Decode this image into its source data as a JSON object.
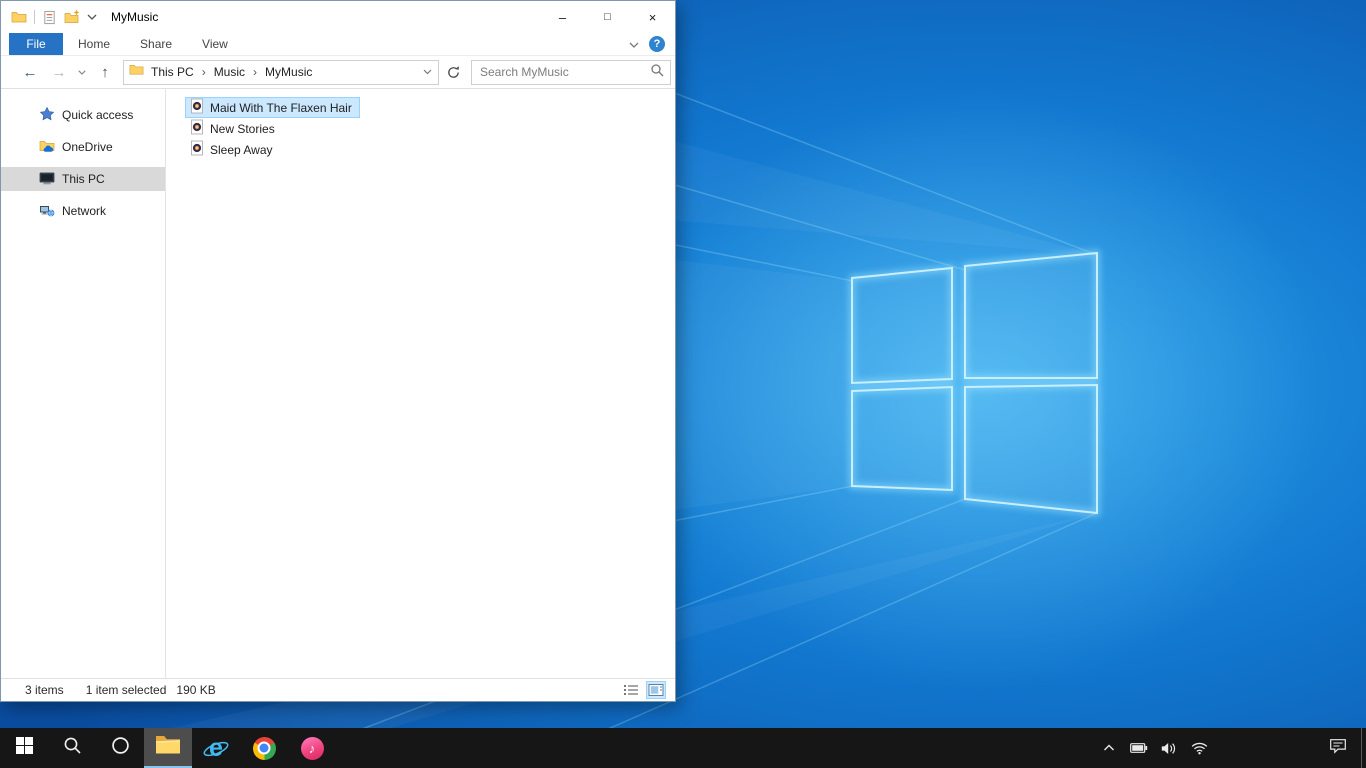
{
  "window": {
    "title": "MyMusic",
    "glyphs": {
      "minimize": "–",
      "maximize": "□",
      "close": "×"
    }
  },
  "ribbon": {
    "tabs": [
      "File",
      "Home",
      "Share",
      "View"
    ],
    "help_glyph": "?"
  },
  "navigation": {
    "back_glyph": "←",
    "forward_glyph": "→",
    "up_glyph": "↑",
    "breadcrumb": [
      "This PC",
      "Music",
      "MyMusic"
    ],
    "separator": "›",
    "search_placeholder": "Search MyMusic"
  },
  "sidebar": {
    "items": [
      {
        "label": "Quick access",
        "icon": "quick-access-star-icon"
      },
      {
        "label": "OneDrive",
        "icon": "onedrive-icon"
      },
      {
        "label": "This PC",
        "icon": "this-pc-icon",
        "selected": true
      },
      {
        "label": "Network",
        "icon": "network-icon"
      }
    ]
  },
  "files": [
    {
      "name": "Maid With The Flaxen Hair",
      "icon": "music-file-icon",
      "selected": true
    },
    {
      "name": "New Stories",
      "icon": "music-file-icon",
      "selected": false
    },
    {
      "name": "Sleep Away",
      "icon": "music-file-icon",
      "selected": false
    }
  ],
  "status_bar": {
    "items_count": "3 items",
    "selection": "1 item selected",
    "size": "190 KB"
  },
  "taskbar": {
    "ie_glyph": "e",
    "itunes_note": "♪",
    "buttons": [
      "start",
      "search",
      "cortana",
      "file-explorer",
      "internet-explorer",
      "chrome",
      "itunes"
    ],
    "active_button": "file-explorer",
    "tray_icons": [
      "hidden-icons-chevron",
      "battery",
      "volume",
      "network"
    ],
    "action_center": "action-center"
  },
  "colors": {
    "file_tab": "#2673c6",
    "selection_fill": "#cce8ff",
    "selection_border": "#99d1ff",
    "sidebar_selected": "#d9d9d9",
    "taskbar": "#161616",
    "accent_underline": "#85c5f0",
    "wallpaper_center": "#2ba1e8",
    "wallpaper_edge": "#0a4da0"
  }
}
